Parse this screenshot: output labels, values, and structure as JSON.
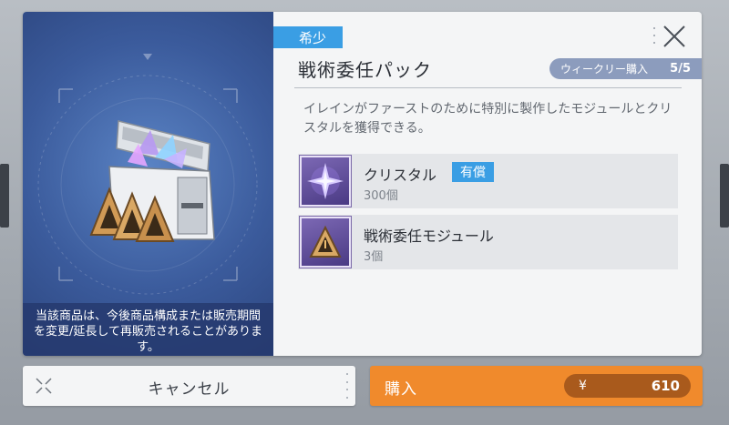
{
  "dialog": {
    "rarity": "希少",
    "title": "戦術委任パック",
    "purchase_limit": {
      "label": "ウィークリー購入",
      "value": "5/5"
    },
    "description": "イレインがファーストのために特別に製作したモジュールとクリスタルを獲得できる。",
    "notice": "当該商品は、今後商品構成または販売期間を変更/延長して再販売されることがあります。",
    "close_icon": "close-icon",
    "items": [
      {
        "name": "クリスタル",
        "badge": "有償",
        "quantity": "300個",
        "icon": "crystal-icon"
      },
      {
        "name": "戦術委任モジュール",
        "quantity": "3個",
        "icon": "module-icon"
      }
    ]
  },
  "footer": {
    "cancel_label": "キャンセル",
    "buy_label": "購入",
    "currency": "¥",
    "price": "610"
  },
  "colors": {
    "accent_blue": "#3a9ee4",
    "buy_orange": "#f08a2c",
    "price_pill": "#a95a1c",
    "panel_blue": "#3b5b9c"
  }
}
